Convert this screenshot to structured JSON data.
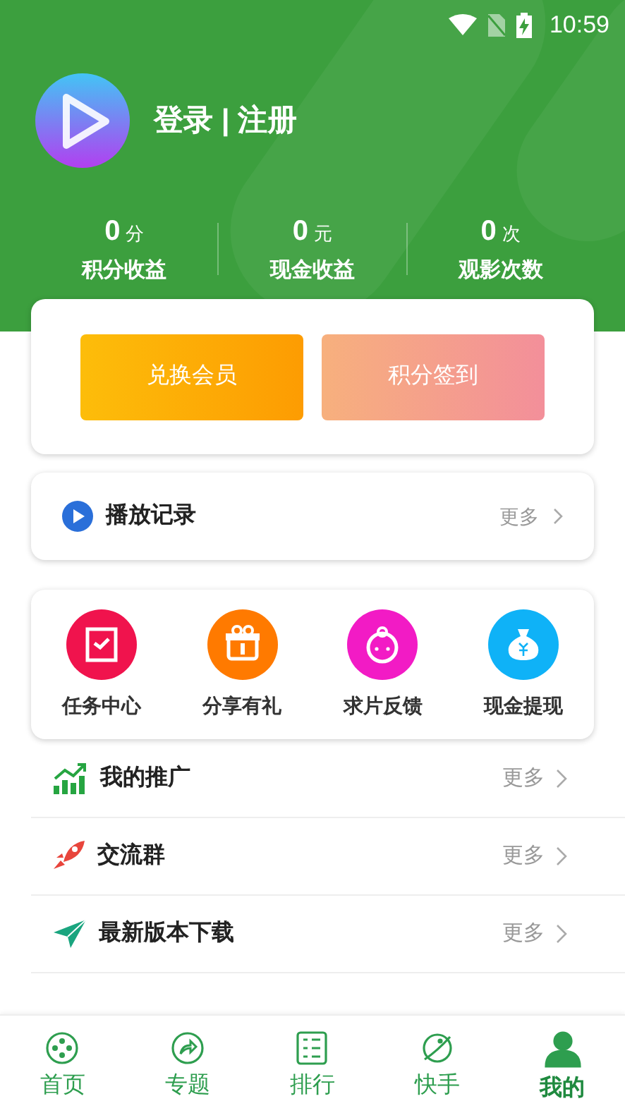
{
  "status_bar": {
    "time": "10:59"
  },
  "profile": {
    "login_text": "登录 | 注册"
  },
  "stats": [
    {
      "value": "0",
      "unit": "分",
      "label": "积分收益"
    },
    {
      "value": "0",
      "unit": "元",
      "label": "现金收益"
    },
    {
      "value": "0",
      "unit": "次",
      "label": "观影次数"
    }
  ],
  "action_buttons": [
    {
      "label": "兑换会员",
      "kind": "exchange"
    },
    {
      "label": "积分签到",
      "kind": "checkin"
    }
  ],
  "history": {
    "title": "播放记录",
    "more": "更多"
  },
  "shortcuts": [
    {
      "label": "任务中心",
      "kind": "task",
      "color": "#f0134d"
    },
    {
      "label": "分享有礼",
      "kind": "gift",
      "color": "#ff7a00"
    },
    {
      "label": "求片反馈",
      "kind": "feedback",
      "color": "#f21bc5"
    },
    {
      "label": "现金提现",
      "kind": "cash",
      "color": "#0fb2f7"
    }
  ],
  "menu": [
    {
      "label": "我的推广",
      "kind": "chart",
      "more": "更多"
    },
    {
      "label": "交流群",
      "kind": "rocket",
      "more": "更多"
    },
    {
      "label": "最新版本下载",
      "kind": "plane",
      "more": "更多"
    }
  ],
  "tabs": [
    {
      "label": "首页",
      "kind": "home",
      "selected": false
    },
    {
      "label": "专题",
      "kind": "topic",
      "selected": false
    },
    {
      "label": "排行",
      "kind": "rank",
      "selected": false
    },
    {
      "label": "快手",
      "kind": "planet",
      "selected": false
    },
    {
      "label": "我的",
      "kind": "me",
      "selected": true
    }
  ]
}
